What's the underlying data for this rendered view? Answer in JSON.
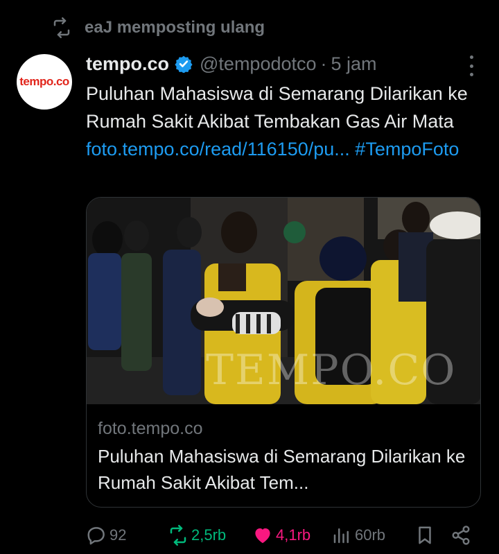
{
  "repost": {
    "text": "eaJ memposting ulang"
  },
  "author": {
    "avatar_text": "tempo.co",
    "name": "tempo.co",
    "handle": "@tempodotco",
    "separator": "·",
    "time": "5 jam"
  },
  "tweet": {
    "text": "Puluhan Mahasiswa di Semarang Dilarikan ke Rumah Sakit Akibat Tembakan Gas Air Mata",
    "link": "foto.tempo.co/read/116150/pu...",
    "hashtag": "#TempoFoto"
  },
  "card": {
    "watermark": "TEMPO.CO",
    "domain": "foto.tempo.co",
    "title": "Puluhan Mahasiswa di Semarang Dilarikan ke Rumah Sakit Akibat Tem..."
  },
  "actions": {
    "replies": "92",
    "reposts": "2,5rb",
    "likes": "4,1rb",
    "views": "60rb"
  },
  "colors": {
    "accent": "#1d9bf0",
    "repost_active": "#00ba7c",
    "like_active": "#f91880",
    "muted": "#71767b"
  }
}
